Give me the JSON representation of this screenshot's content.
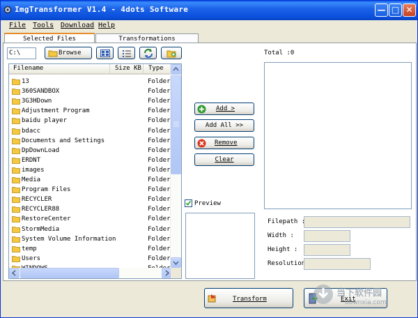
{
  "window": {
    "title": "ImgTransformer V1.4 - 4dots Software",
    "minimize_glyph": "—",
    "maximize_glyph": "□",
    "close_glyph": "✕"
  },
  "menu": [
    {
      "label": "File"
    },
    {
      "label": "Tools"
    },
    {
      "label": "Download"
    },
    {
      "label": "Help"
    }
  ],
  "tabs": [
    {
      "label": "Selected Files",
      "active": true
    },
    {
      "label": "Transformations",
      "active": false
    }
  ],
  "path_input": {
    "value": "C:\\"
  },
  "browse_label": "Browse",
  "file_list": {
    "headers": {
      "name": "Filename",
      "size": "Size KB",
      "type": "Type"
    },
    "rows": [
      {
        "name": "13",
        "type": "Folder"
      },
      {
        "name": "360SANDBOX",
        "type": "Folder"
      },
      {
        "name": "3G3HDown",
        "type": "Folder"
      },
      {
        "name": "Adjustment Program",
        "type": "Folder"
      },
      {
        "name": "baidu player",
        "type": "Folder"
      },
      {
        "name": "bdacc",
        "type": "Folder"
      },
      {
        "name": "Documents and Settings",
        "type": "Folder"
      },
      {
        "name": "DpDownLoad",
        "type": "Folder"
      },
      {
        "name": "ERDNT",
        "type": "Folder"
      },
      {
        "name": "images",
        "type": "Folder"
      },
      {
        "name": "Media",
        "type": "Folder"
      },
      {
        "name": "Program Files",
        "type": "Folder"
      },
      {
        "name": "RECYCLER",
        "type": "Folder"
      },
      {
        "name": "RECYCLER88",
        "type": "Folder"
      },
      {
        "name": "RestoreCenter",
        "type": "Folder"
      },
      {
        "name": "StormMedia",
        "type": "Folder"
      },
      {
        "name": "System Volume Information",
        "type": "Folder"
      },
      {
        "name": "temp",
        "type": "Folder"
      },
      {
        "name": "Users",
        "type": "Folder"
      },
      {
        "name": "WINDOWS",
        "type": "Folder"
      }
    ]
  },
  "actions": {
    "add": "Add >",
    "add_all": "Add All >>",
    "remove": "Remove",
    "clear": "Clear"
  },
  "total_label": "Total :0",
  "preview": {
    "label": "Preview",
    "checked": true
  },
  "info": {
    "filepath": "Filepath :",
    "width": "Width :",
    "height": "Height :",
    "resolution": "Resolution :"
  },
  "bottom": {
    "transform": "Transform",
    "exit": "Exit"
  },
  "watermark": {
    "line1": "当下软件园",
    "line2": "downxia.com"
  },
  "colors": {
    "titlebar": "#0a5be4",
    "folder": "#f5c842",
    "accent_tab": "#e68b2c"
  }
}
